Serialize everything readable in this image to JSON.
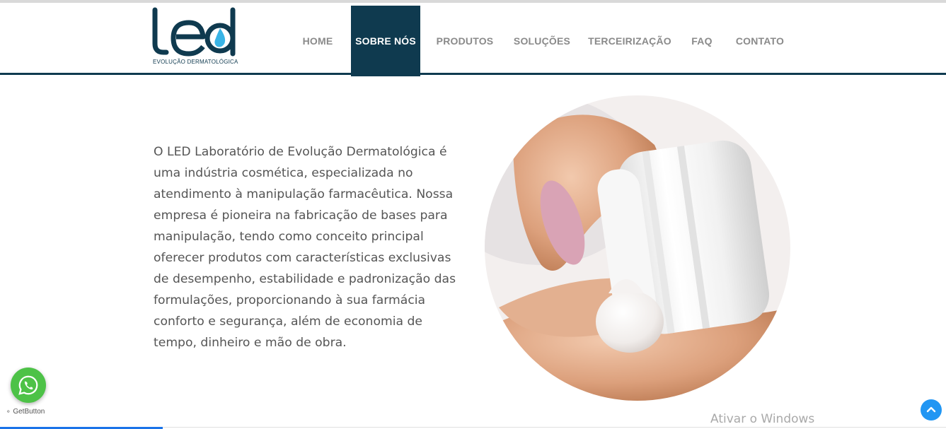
{
  "brand": {
    "logo_word": "led",
    "tagline": "EVOLUÇÃO DERMATOLÓGICA",
    "colors": {
      "primary": "#0f3a4f",
      "accent": "#39b4e6"
    }
  },
  "nav": {
    "items": [
      {
        "label": "HOME",
        "active": false
      },
      {
        "label": "SOBRE NÓS",
        "active": true
      },
      {
        "label": "PRODUTOS",
        "active": false
      },
      {
        "label": "SOLUÇÕES",
        "active": false
      },
      {
        "label": "TERCEIRIZAÇÃO",
        "active": false
      },
      {
        "label": "FAQ",
        "active": false
      },
      {
        "label": "CONTATO",
        "active": false
      }
    ]
  },
  "about": {
    "text": "O LED Laboratório de Evolução Dermatológica é uma indústria cosmética, especializada no atendimento à manipulação farmacêutica. Nossa empresa é pioneira na fabricação de bases para manipulação, tendo como conceito principal oferecer produtos com características exclusivas de desempenho, estabilidade e padronização das formulações, proporcionando à sua farmácia conforto e segurança, além de economia de tempo, dinheiro e mão de obra."
  },
  "widgets": {
    "whatsapp_icon": "whatsapp-icon",
    "getbutton_label": "GetButton",
    "scroll_top_icon": "arrow-up-icon"
  },
  "os": {
    "watermark": "Ativar o Windows"
  }
}
